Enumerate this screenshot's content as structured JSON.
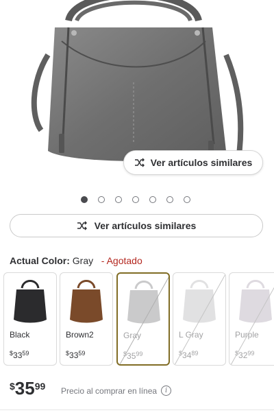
{
  "product": {
    "image_icon": "handbag-photo",
    "similar_label": "Ver artículos similares",
    "carousel": {
      "count": 7,
      "active_index": 0
    }
  },
  "variant": {
    "label": "Actual Color:",
    "value": "Gray",
    "separator": "-",
    "status": "Agotado",
    "status_color": "#b3261e"
  },
  "swatches": [
    {
      "name": "Black",
      "price_int": "33",
      "price_dec": "59",
      "currency": "$",
      "color": "#2b2b2d",
      "selected": false,
      "unavailable": false
    },
    {
      "name": "Brown2",
      "price_int": "33",
      "price_dec": "59",
      "currency": "$",
      "color": "#7a4a2a",
      "selected": false,
      "unavailable": false
    },
    {
      "name": "Gray",
      "price_int": "35",
      "price_dec": "99",
      "currency": "$",
      "color": "#8c8c8e",
      "selected": true,
      "unavailable": true
    },
    {
      "name": "L Gray",
      "price_int": "34",
      "price_dec": "89",
      "currency": "$",
      "color": "#bdbdbf",
      "selected": false,
      "unavailable": true
    },
    {
      "name": "Purple",
      "price_int": "32",
      "price_dec": "99",
      "currency": "$",
      "color": "#b8aebb",
      "selected": false,
      "unavailable": true
    }
  ],
  "price": {
    "currency": "$",
    "integer": "35",
    "decimal": "99",
    "note": "Precio al comprar en línea",
    "info_icon": "info-icon"
  },
  "colors": {
    "accent_selected": "#806c24"
  }
}
